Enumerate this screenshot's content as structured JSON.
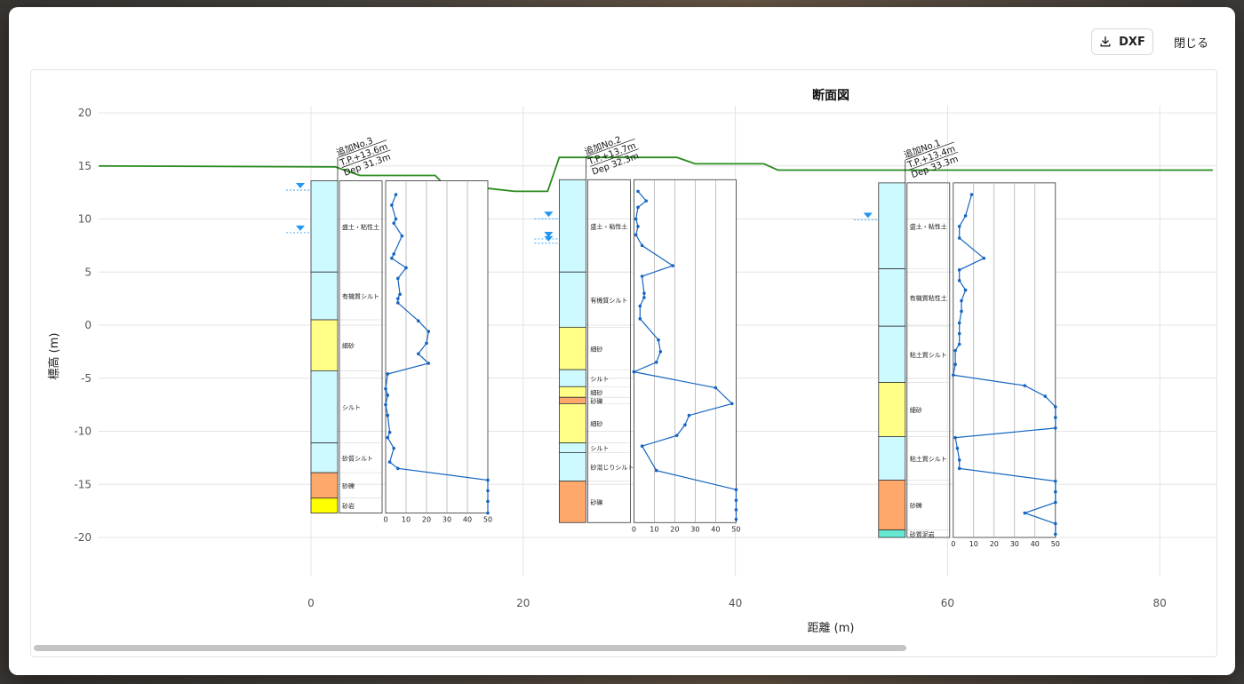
{
  "toolbar": {
    "dxf_label": "DXF",
    "close_label": "閉じる"
  },
  "icons": {
    "download": "download-icon"
  },
  "colors": {
    "ground": "#2a8a1f",
    "data_line": "#1565c0",
    "water": "#2196f3"
  },
  "chart_data": {
    "type": "line",
    "title": "断面図",
    "xlabel": "距離 (m)",
    "ylabel": "標高 (m)",
    "xlim": [
      -20,
      85
    ],
    "ylim": [
      -22,
      22
    ],
    "xticks": [
      0,
      20,
      40,
      60,
      80
    ],
    "yticks": [
      20,
      15,
      10,
      5,
      0,
      -5,
      -10,
      -15,
      -20
    ],
    "grid": true,
    "ground_line": {
      "name": "ground",
      "x": [
        -20,
        2.3,
        4.6,
        11.7,
        12.9,
        16.5,
        19.2,
        22.3,
        23.4,
        34.5,
        36.2,
        42.7,
        44.0,
        85
      ],
      "y": [
        15.0,
        14.9,
        14.1,
        14.1,
        12.9,
        12.9,
        12.6,
        12.6,
        15.8,
        15.8,
        15.2,
        15.2,
        14.6,
        14.6
      ]
    },
    "boreholes": [
      {
        "x": 0,
        "label_lines": [
          "追加No.3",
          "T.P.+13.6m",
          "Dep 31.3m"
        ],
        "top": 13.6,
        "water_levels": [
          12.8,
          8.8
        ],
        "layers": [
          {
            "name": "盛土・粘性土",
            "top": 13.6,
            "bottom": 5.0,
            "color": "#ccfaff"
          },
          {
            "name": "有機質シルト",
            "top": 5.0,
            "bottom": 0.5,
            "color": "#ccfaff"
          },
          {
            "name": "細砂",
            "top": 0.5,
            "bottom": -4.3,
            "color": "#ffff88"
          },
          {
            "name": "シルト",
            "top": -4.3,
            "bottom": -11.1,
            "color": "#ccfaff"
          },
          {
            "name": "砂質シルト",
            "top": -11.1,
            "bottom": -13.9,
            "color": "#ccfaff"
          },
          {
            "name": "砂礫",
            "top": -13.9,
            "bottom": -16.3,
            "color": "#ffa86c"
          },
          {
            "name": "砂岩",
            "top": -16.3,
            "bottom": -17.7,
            "color": "#ffff00"
          }
        ],
        "n_values": {
          "depth": [
            12.3,
            11.3,
            10.0,
            9.6,
            8.4,
            6.7,
            6.3,
            5.4,
            4.4,
            2.9,
            2.5,
            2.1,
            0.4,
            -0.6,
            -1.7,
            -2.7,
            -3.6,
            -4.6,
            -6.0,
            -6.6,
            -7.5,
            -8.5,
            -10.1,
            -10.6,
            -11.6,
            -12.9,
            -13.5,
            -14.6,
            -15.6,
            -16.6,
            -17.7
          ],
          "n": [
            5,
            3,
            5,
            4,
            8,
            4,
            3,
            10,
            6,
            7,
            6,
            6,
            16,
            21,
            20,
            16,
            21,
            1,
            0,
            1,
            0,
            1,
            2,
            1,
            4,
            2,
            6,
            50,
            50,
            50,
            50
          ]
        },
        "n_axis_ticks": [
          "0",
          "10",
          "20",
          "30",
          "40",
          "50"
        ]
      },
      {
        "x": 23.4,
        "label_lines": [
          "追加No.2",
          "T.P.+13.7m",
          "Dep 32.3m"
        ],
        "top": 13.7,
        "water_levels": [
          10.1,
          8.2,
          7.8
        ],
        "layers": [
          {
            "name": "盛土・粘性土",
            "top": 13.7,
            "bottom": 5.0,
            "color": "#ccfaff"
          },
          {
            "name": "有機質シルト",
            "top": 5.0,
            "bottom": -0.2,
            "color": "#ccfaff"
          },
          {
            "name": "細砂",
            "top": -0.2,
            "bottom": -4.2,
            "color": "#ffff88"
          },
          {
            "name": "シルト",
            "top": -4.2,
            "bottom": -5.8,
            "color": "#ccfaff"
          },
          {
            "name": "細砂",
            "top": -5.8,
            "bottom": -6.8,
            "color": "#ffff88"
          },
          {
            "name": "砂礫",
            "top": -6.8,
            "bottom": -7.4,
            "color": "#ffa86c"
          },
          {
            "name": "細砂",
            "top": -7.4,
            "bottom": -11.1,
            "color": "#ffff88"
          },
          {
            "name": "シルト",
            "top": -11.1,
            "bottom": -12.0,
            "color": "#ccfaff"
          },
          {
            "name": "砂混じりシルト",
            "top": -12.0,
            "bottom": -14.7,
            "color": "#ccfaff"
          },
          {
            "name": "砂礫",
            "top": -14.7,
            "bottom": -18.6,
            "color": "#ffa86c"
          }
        ],
        "n_values": {
          "depth": [
            12.6,
            11.7,
            11.1,
            10.0,
            9.3,
            8.5,
            7.5,
            5.6,
            4.6,
            3.0,
            2.6,
            1.8,
            0.6,
            -1.4,
            -2.5,
            -3.5,
            -4.4,
            -5.9,
            -7.4,
            -8.5,
            -9.4,
            -10.4,
            -11.4,
            -13.7,
            -15.5,
            -16.5,
            -17.4,
            -18.3
          ],
          "n": [
            2,
            6,
            2,
            1,
            2,
            1,
            4,
            19,
            4,
            5,
            5,
            3,
            3,
            12,
            13,
            11,
            0,
            40,
            48,
            27,
            25,
            21,
            4,
            11,
            50,
            50,
            50,
            50
          ]
        },
        "n_axis_ticks": [
          "0",
          "10",
          "20",
          "30",
          "40",
          "50"
        ]
      },
      {
        "x": 53.5,
        "label_lines": [
          "追加No.1",
          "T.P.+13.4m",
          "Dep 33.3m"
        ],
        "top": 13.4,
        "water_levels": [
          10.0
        ],
        "layers": [
          {
            "name": "盛土・粘性土",
            "top": 13.4,
            "bottom": 5.3,
            "color": "#ccfaff"
          },
          {
            "name": "有機質粘性土",
            "top": 5.3,
            "bottom": -0.1,
            "color": "#ccfaff"
          },
          {
            "name": "粘土質シルト",
            "top": -0.1,
            "bottom": -5.4,
            "color": "#ccfaff"
          },
          {
            "name": "細砂",
            "top": -5.4,
            "bottom": -10.5,
            "color": "#ffff88"
          },
          {
            "name": "粘土質シルト",
            "top": -10.5,
            "bottom": -14.6,
            "color": "#ccfaff"
          },
          {
            "name": "砂礫",
            "top": -14.6,
            "bottom": -19.3,
            "color": "#ffa86c"
          },
          {
            "name": "砂質泥岩",
            "top": -19.3,
            "bottom": -20.0,
            "color": "#66e8d2"
          }
        ],
        "n_values": {
          "depth": [
            12.3,
            10.3,
            9.3,
            8.2,
            6.3,
            5.2,
            4.2,
            3.3,
            2.3,
            1.3,
            0.2,
            -0.8,
            -1.8,
            -2.4,
            -3.7,
            -4.7,
            -5.7,
            -6.7,
            -7.7,
            -8.7,
            -9.7,
            -10.6,
            -11.6,
            -12.7,
            -13.5,
            -14.7,
            -15.7,
            -16.7,
            -17.7,
            -18.7,
            -19.7
          ],
          "n": [
            9,
            6,
            3,
            3,
            15,
            3,
            3,
            6,
            4,
            4,
            3,
            3,
            3,
            1,
            1,
            0,
            35,
            45,
            50,
            50,
            50,
            1,
            2,
            3,
            3,
            50,
            50,
            50,
            35,
            50,
            50
          ]
        },
        "n_axis_ticks": [
          "0",
          "10",
          "20",
          "30",
          "40",
          "50"
        ]
      }
    ]
  }
}
